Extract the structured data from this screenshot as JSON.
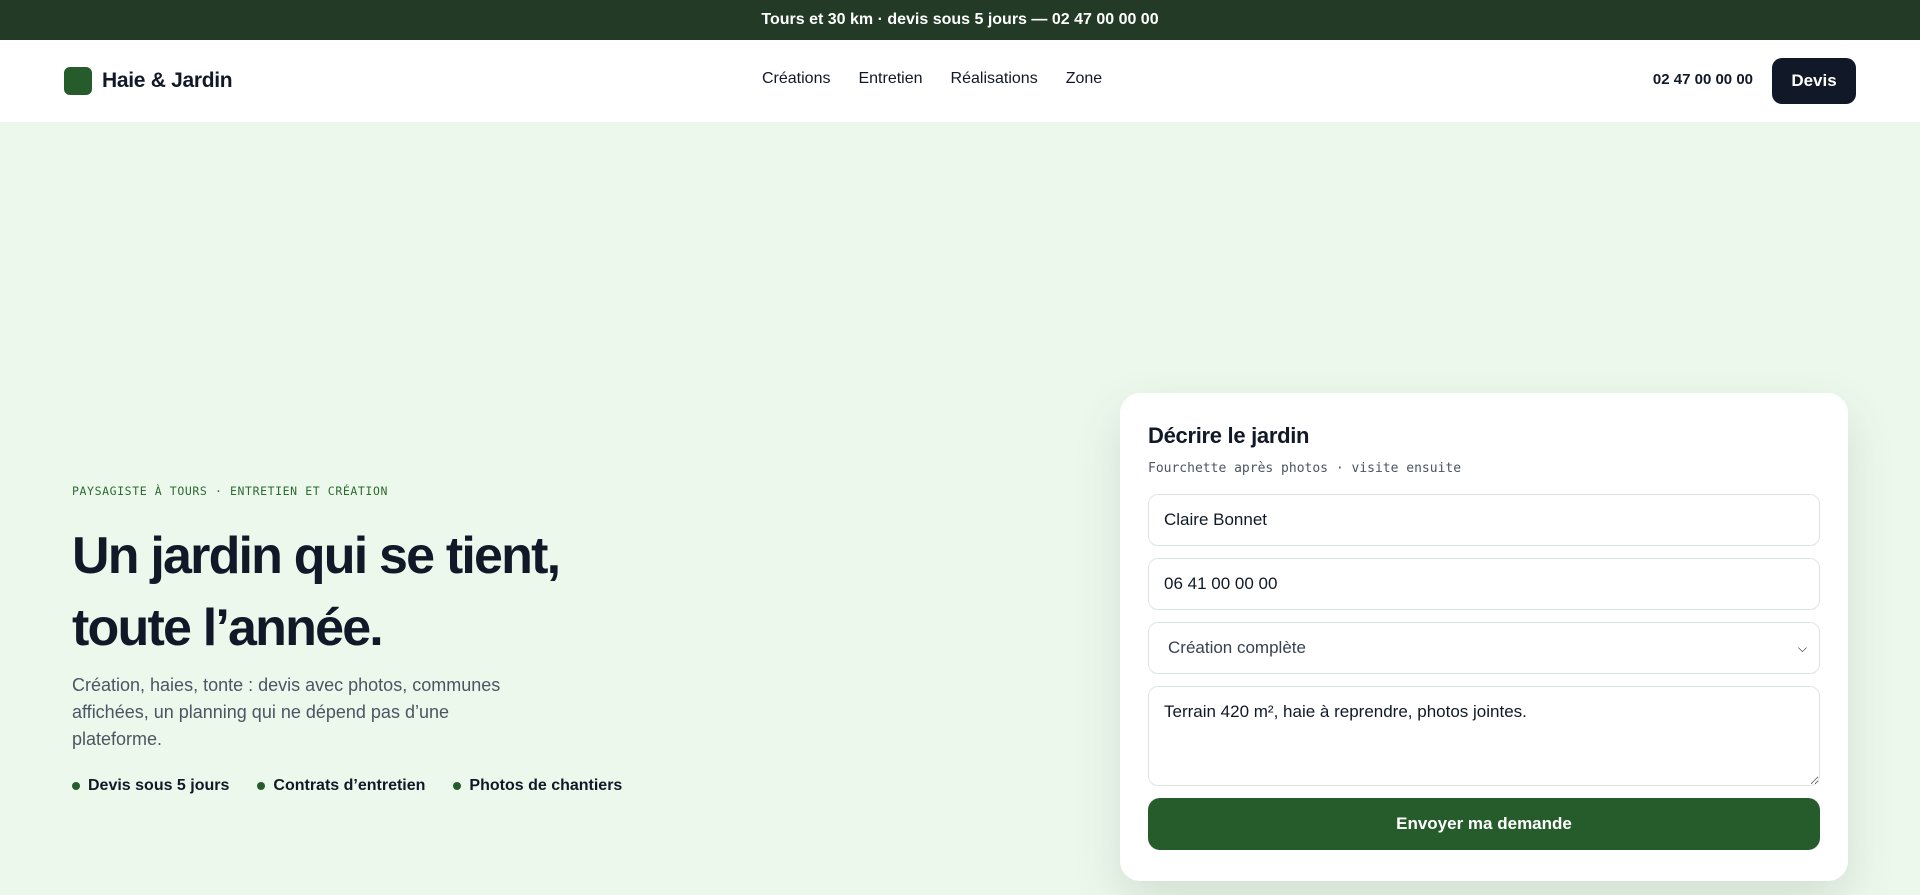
{
  "topbar": {
    "text": "Tours et 30 km · devis sous 5 jours — 02 47 00 00 00"
  },
  "header": {
    "brand": "Haie & Jardin",
    "nav": [
      "Créations",
      "Entretien",
      "Réalisations",
      "Zone"
    ],
    "phone": "02 47 00 00 00",
    "cta": "Devis"
  },
  "hero": {
    "eyebrow": "PAYSAGISTE À TOURS · ENTRETIEN ET CRÉATION",
    "headline_line1": "Un jardin qui se tient,",
    "headline_line2": "toute l’année.",
    "lead": "Création, haies, tonte : devis avec photos, communes affichées, un planning qui ne dépend pas d’une plateforme.",
    "bullets": [
      "Devis sous 5 jours",
      "Contrats d’entretien",
      "Photos de chantiers"
    ]
  },
  "form": {
    "title": "Décrire le jardin",
    "subtitle": "Fourchette après photos · visite ensuite",
    "name_value": "Claire Bonnet",
    "phone_value": "06 41 00 00 00",
    "service_selected": "Création complète",
    "message_value": "Terrain 420 m², haie à reprendre, photos jointes.",
    "submit_label": "Envoyer ma demande"
  },
  "colors": {
    "topbar_bg": "#223a26",
    "accent_green": "#265c2c",
    "hero_bg": "#edf8ec",
    "dark_button": "#111827"
  }
}
